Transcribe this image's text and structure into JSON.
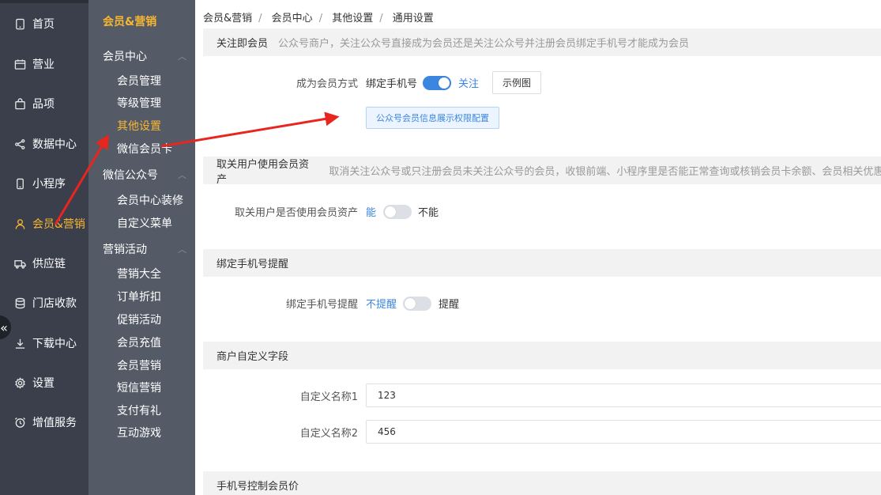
{
  "nav1": {
    "items": [
      {
        "label": "首页",
        "icon": "tablet-icon"
      },
      {
        "label": "营业",
        "icon": "calendar-icon"
      },
      {
        "label": "品项",
        "icon": "bag-icon"
      },
      {
        "label": "数据中心",
        "icon": "share-icon"
      },
      {
        "label": "小程序",
        "icon": "phone-icon"
      },
      {
        "label": "会员&营销",
        "icon": "user-icon"
      },
      {
        "label": "供应链",
        "icon": "truck-icon"
      },
      {
        "label": "门店收款",
        "icon": "database-icon"
      },
      {
        "label": "下载中心",
        "icon": "download-icon"
      },
      {
        "label": "设置",
        "icon": "gear-icon"
      },
      {
        "label": "增值服务",
        "icon": "alarm-icon"
      }
    ],
    "collapse_glyph": "«"
  },
  "nav2": {
    "title": "会员&营销",
    "groups": [
      {
        "label": "会员中心",
        "items": [
          "会员管理",
          "等级管理",
          "其他设置",
          "微信会员卡"
        ]
      },
      {
        "label": "微信公众号",
        "items": [
          "会员中心装修",
          "自定义菜单"
        ]
      },
      {
        "label": "营销活动",
        "items": [
          "营销大全",
          "订单折扣",
          "促销活动",
          "会员充值",
          "会员营销",
          "短信营销",
          "支付有礼",
          "互动游戏"
        ]
      }
    ]
  },
  "breadcrumb": [
    "会员&营销",
    "会员中心",
    "其他设置",
    "通用设置"
  ],
  "sections": {
    "follow": {
      "title": "关注即会员",
      "desc": "公众号商户，关注公众号直接成为会员还是关注公众号并注册会员绑定手机号才能成为会员",
      "row_label": "成为会员方式",
      "opt_left": "绑定手机号",
      "opt_right": "关注",
      "example_button": "示例图",
      "config_button": "公众号会员信息展示权限配置"
    },
    "unfollow": {
      "title": "取关用户使用会员资产",
      "desc": "取消关注公众号或只注册会员未关注公众号的会员，收银前端、小程序里是否能正常查询或核销会员卡余额、会员相关优惠",
      "row_label": "取关用户是否使用会员资产",
      "opt_left": "能",
      "opt_right": "不能"
    },
    "bind_remind": {
      "title": "绑定手机号提醒",
      "row_label": "绑定手机号提醒",
      "opt_left": "不提醒",
      "opt_right": "提醒"
    },
    "custom_fields": {
      "title": "商户自定义字段",
      "field1_label": "自定义名称1",
      "field1_value": "123",
      "field2_label": "自定义名称2",
      "field2_value": "456"
    },
    "phone_price": {
      "title": "手机号控制会员价"
    }
  },
  "colors": {
    "accent": "#f7b731",
    "primary": "#3b86e0",
    "annotation_arrow": "#e8251f"
  }
}
